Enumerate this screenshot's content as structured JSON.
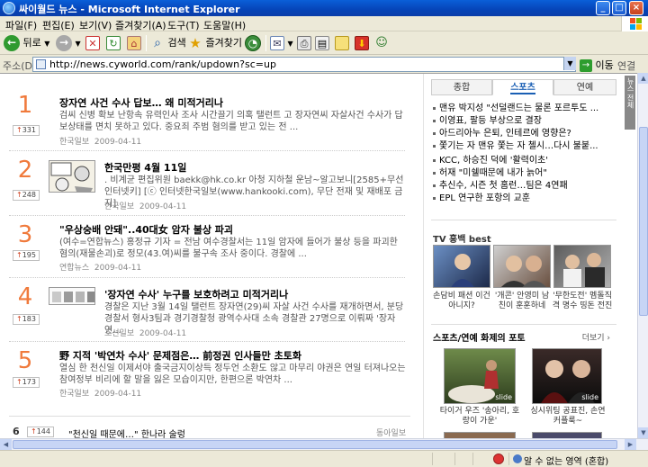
{
  "window": {
    "title": "싸이월드 뉴스 - Microsoft Internet Explorer"
  },
  "menu": [
    "파일(F)",
    "편집(E)",
    "보기(V)",
    "즐겨찾기(A)",
    "도구(T)",
    "도움말(H)"
  ],
  "toolbar": {
    "back": "뒤로",
    "search": "검색",
    "favorites": "즐겨찾기"
  },
  "address": {
    "label": "주소(D)",
    "url": "http://news.cyworld.com/rank/updown?sc=up",
    "go": "이동",
    "links": "연결"
  },
  "news": [
    {
      "rank": "1",
      "count": "331",
      "title": "장자연 사건 수사 답보… 왜 미적거리나",
      "desc": "검씨 신병 확보 난항속 유력인사 조사 시간끌기 의혹 탤런트 고 장자연씨 자살사건 수사가 답보상태를 면치 못하고 있다. 중요죄 주범 혐의를 받고 있는 전 ...",
      "source": "한국일보",
      "date": "2009-04-11"
    },
    {
      "rank": "2",
      "count": "248",
      "title": "한국만평 4월 11일",
      "desc": ". 비계균 편집위원 baekk@hk.co.kr 아청 지하철 운남~알고보니[2585+무선인터넷키] [ⓒ 인터넷한국일보(www.hankooki.com), 무단 전재 및 재배포 금지]",
      "source": "한국일보",
      "date": "2009-04-11"
    },
    {
      "rank": "3",
      "count": "195",
      "title": "\"우상숭배 안돼\"..40대女 암자 불상 파괴",
      "desc": "(여수=연합뉴스) 홍정규 기자 = 전남 여수경찰서는 11일 암자에 들어가 불상 등을 파괴한 혐의(재물손괴)로 정모(43.여)씨를 불구속 조사 중이다. 경찰에 ...",
      "source": "연합뉴스",
      "date": "2009-04-11"
    },
    {
      "rank": "4",
      "count": "183",
      "title": "'장자연 수사' 누구를 보호하려고 미적거리나",
      "desc": "경찰은 지난 3월 14일 탤런트 장자연(29)씨 자살 사건 수사를 재개하면서, 분당경찰서 형사3팀과 경기경찰청 광역수사대 소속 경찰관 27명으로 이뤄짜 '장자연...",
      "source": "조선일보",
      "date": "2009-04-11"
    },
    {
      "rank": "5",
      "count": "173",
      "title": "野 지적 '박연차 수사' 문제점은… 前정권 인사들만 초토화",
      "desc": "열심 한 천신일 이제서야 출국금지이상득 정두언 소환도 않고 마무리 야권은 연일 터져나오는 참여정부 비리에 할 말을 잃은 모습이지만, 한편으론 박연차 ...",
      "source": "한국일보",
      "date": "2009-04-11"
    },
    {
      "rank": "6",
      "count": "144",
      "title": "\"천신일 때문에…\" 한나라 술렁",
      "desc": "",
      "source": "동아일보",
      "date": ""
    }
  ],
  "right": {
    "tabs": [
      "종합",
      "스포츠",
      "연예"
    ],
    "sports": [
      "맨유 박지성 \"선덜랜드는 물론 포르투도 ...",
      "이영표, 팔등 부상으로 결장",
      "아드리아누 은퇴, 인테르에 영향은?",
      "쫓기는 자 맨유 쫓는 자 첼시…다시 불붙...",
      "KCC, 하승진 덕에 '활력이초'",
      "허재 \"미쉘때문에 내가 늙어\"",
      "추신수, 시즌 첫 홈런…팀은 4연패",
      "EPL 연구한 포항의 교훈"
    ],
    "tv_title": "TV 홍백 best",
    "tv_items": [
      {
        "caption": "손담비 패션 이건 아니지?"
      },
      {
        "caption": "'개콘' 안영미 남친이 훈훈하네"
      },
      {
        "caption": "'무한도전' 멤돌직격 명수 띵돈 전진"
      }
    ],
    "photo_title": "스포츠/연예 화제의 포토",
    "photo_more": "더보기 ›",
    "photos": [
      {
        "caption": "타이거 우즈 '송아리, 호랑이 가운'",
        "badge": "slide"
      },
      {
        "caption": "싱시위팅 공표진, 손연 커플룩~",
        "badge": "slide"
      }
    ]
  },
  "sidewing": "뉴스 전체",
  "status": {
    "zone": "알 수 없는 영역 (혼합)"
  }
}
